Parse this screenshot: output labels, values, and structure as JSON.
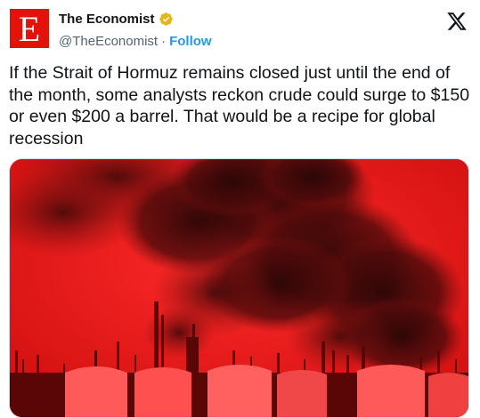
{
  "account": {
    "avatar_letter": "E",
    "display_name": "The Economist",
    "handle": "@TheEconomist",
    "separator": "·",
    "follow_label": "Follow",
    "avatar_color": "#e3120b",
    "verified_color": "#e2b719"
  },
  "brand": {
    "icon": "x-logo-icon"
  },
  "tweet": {
    "text": "If the Strait of Hormuz remains closed just until the end of the month, some analysts reckon crude could surge to $150 or even $200 a barrel. That would be a recipe for global recession"
  },
  "media": {
    "description_icon": "refinery-smoke-image",
    "tint_color": "#e81e1e"
  },
  "colors": {
    "text": "#0f1419",
    "secondary": "#536471",
    "link": "#1d9bf0"
  }
}
